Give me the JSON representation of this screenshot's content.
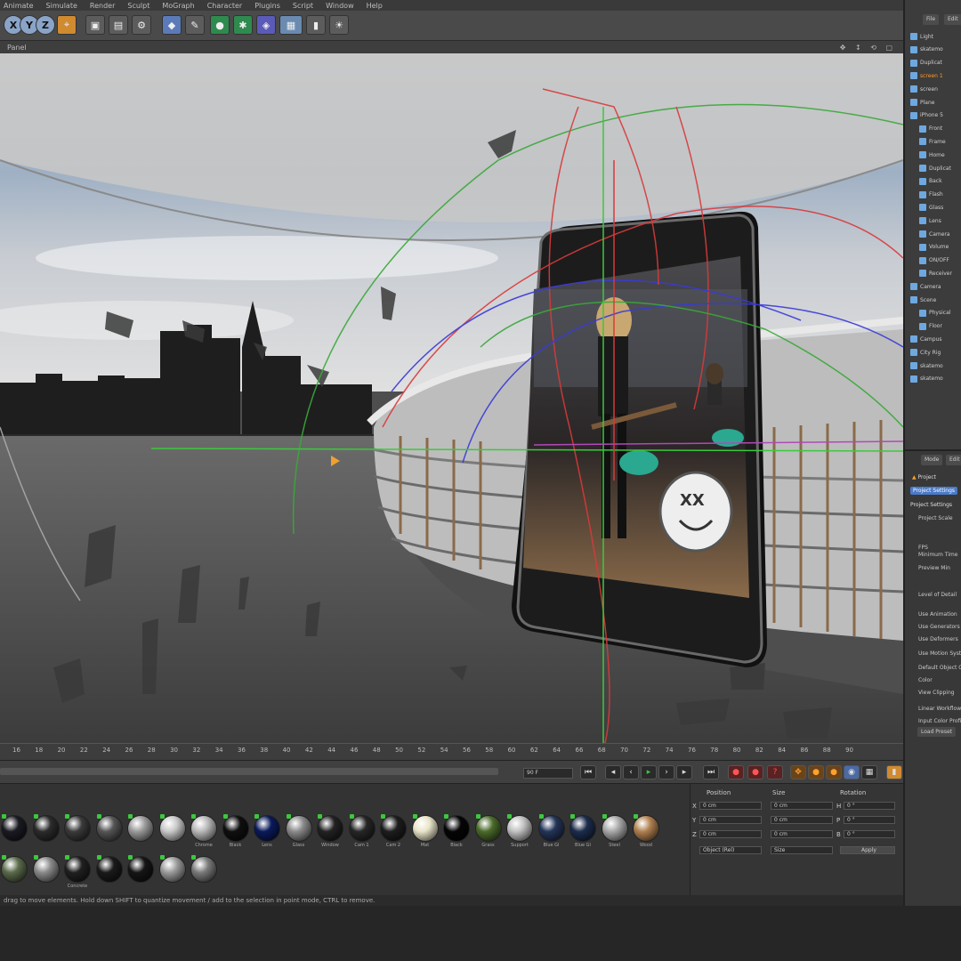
{
  "menubar": [
    "Animate",
    "Simulate",
    "Render",
    "Sculpt",
    "MoGraph",
    "Character",
    "Plugins",
    "Script",
    "Window",
    "Help"
  ],
  "viewport_label": "Panel",
  "timeline_ticks": [
    "16",
    "18",
    "20",
    "22",
    "24",
    "26",
    "28",
    "30",
    "32",
    "34",
    "36",
    "38",
    "40",
    "42",
    "44",
    "46",
    "48",
    "50",
    "52",
    "54",
    "56",
    "58",
    "60",
    "62",
    "64",
    "66",
    "68",
    "70",
    "72",
    "74",
    "76",
    "78",
    "80",
    "82",
    "84",
    "86",
    "88",
    "90"
  ],
  "transport": {
    "frame_field": "90 F"
  },
  "materials": {
    "row1": [
      {
        "label": "",
        "color": "#1a1a22"
      },
      {
        "label": "",
        "color": "#2b2b2b"
      },
      {
        "label": "",
        "color": "#3a3a3a"
      },
      {
        "label": "",
        "color": "#555555"
      },
      {
        "label": "",
        "color": "#9a9a9a"
      },
      {
        "label": "",
        "color": "#c8c8c8"
      },
      {
        "label": "Chrome",
        "color": "#b8b8b8"
      },
      {
        "label": "Black",
        "color": "#0f0f0f"
      },
      {
        "label": "Lens",
        "color": "#0a1a5a"
      },
      {
        "label": "Glass",
        "color": "#8a8a8a"
      },
      {
        "label": "Window",
        "color": "#222222"
      },
      {
        "label": "Cam 1",
        "color": "#262626"
      },
      {
        "label": "Cam 2",
        "color": "#1d1d1d"
      },
      {
        "label": "Mat",
        "color": "#e8e4c8"
      },
      {
        "label": "Black",
        "color": "#050505"
      },
      {
        "label": "Grass",
        "color": "#4a6a2a"
      },
      {
        "label": "Support",
        "color": "#c0c0c0"
      },
      {
        "label": "Blue Gl",
        "color": "#243458"
      },
      {
        "label": "Blue Gl",
        "color": "#1c2c4c"
      },
      {
        "label": "Steel",
        "color": "#a8a8a8"
      },
      {
        "label": "Wood",
        "color": "#b08050"
      }
    ],
    "row2": [
      {
        "label": "",
        "color": "#5a6a4a"
      },
      {
        "label": "",
        "color": "#8a8a8a"
      },
      {
        "label": "Concrete",
        "color": "#202020"
      },
      {
        "label": "",
        "color": "#1a1a1a"
      },
      {
        "label": "",
        "color": "#151515"
      },
      {
        "label": "",
        "color": "#9a9a9a"
      },
      {
        "label": "",
        "color": "#7a7a7a"
      }
    ]
  },
  "coords": {
    "headers": [
      "Position",
      "Size",
      "Rotation"
    ],
    "rows": [
      {
        "axis": "X",
        "pos": "0 cm",
        "size": "0 cm",
        "rot_axis": "H",
        "rot": "0 °"
      },
      {
        "axis": "Y",
        "pos": "0 cm",
        "size": "0 cm",
        "rot_axis": "P",
        "rot": "0 °"
      },
      {
        "axis": "Z",
        "pos": "0 cm",
        "size": "0 cm",
        "rot_axis": "B",
        "rot": "0 °"
      }
    ],
    "mode_select": "Object (Rel)",
    "size_select": "Size",
    "apply_label": "Apply"
  },
  "status_text": "drag to move elements. Hold down SHIFT to quantize movement / add to the selection in point mode, CTRL to remove.",
  "object_manager": {
    "tabs": [
      "File",
      "Edit"
    ],
    "items": [
      {
        "label": "Light",
        "selected": false
      },
      {
        "label": "skatemo",
        "selected": false
      },
      {
        "label": "Duplicat",
        "selected": false
      },
      {
        "label": "screen 1",
        "selected": true
      },
      {
        "label": "screen",
        "selected": false
      },
      {
        "label": "Plane",
        "selected": false
      },
      {
        "label": "iPhone 5",
        "selected": false
      },
      {
        "label": "Front",
        "selected": false
      },
      {
        "label": "Frame",
        "selected": false
      },
      {
        "label": "Home",
        "selected": false
      },
      {
        "label": "Duplicat",
        "selected": false
      },
      {
        "label": "Back",
        "selected": false
      },
      {
        "label": "Flash",
        "selected": false
      },
      {
        "label": "Glass",
        "selected": false
      },
      {
        "label": "Lens",
        "selected": false
      },
      {
        "label": "Camera",
        "selected": false
      },
      {
        "label": "Volume",
        "selected": false
      },
      {
        "label": "ON/OFF",
        "selected": false
      },
      {
        "label": "Receiver",
        "selected": false
      },
      {
        "label": "Camera",
        "selected": false
      },
      {
        "label": "Scene",
        "selected": false
      },
      {
        "label": "Physical",
        "selected": false
      },
      {
        "label": "Floor",
        "selected": false
      },
      {
        "label": "Campus",
        "selected": false
      },
      {
        "label": "City Rig",
        "selected": false
      },
      {
        "label": "skatemo",
        "selected": false
      },
      {
        "label": "skatemo",
        "selected": false
      }
    ]
  },
  "attribute_manager": {
    "tabs": [
      "Mode",
      "Edit"
    ],
    "title": "Project",
    "section_button": "Project Settings",
    "heading": "Project Settings",
    "rows": [
      "Project Scale",
      "FPS",
      "Minimum Time",
      "Preview Min",
      "Level of Detail",
      "Use Animation",
      "Use Generators",
      "Use Deformers",
      "Use Motion System",
      "Default Object Color",
      "Color",
      "View Clipping",
      "Linear Workflow",
      "Input Color Profile"
    ],
    "load_button": "Load Preset"
  },
  "colors": {
    "accent": "#f0a030",
    "selection_blue": "#4a7ac8"
  }
}
